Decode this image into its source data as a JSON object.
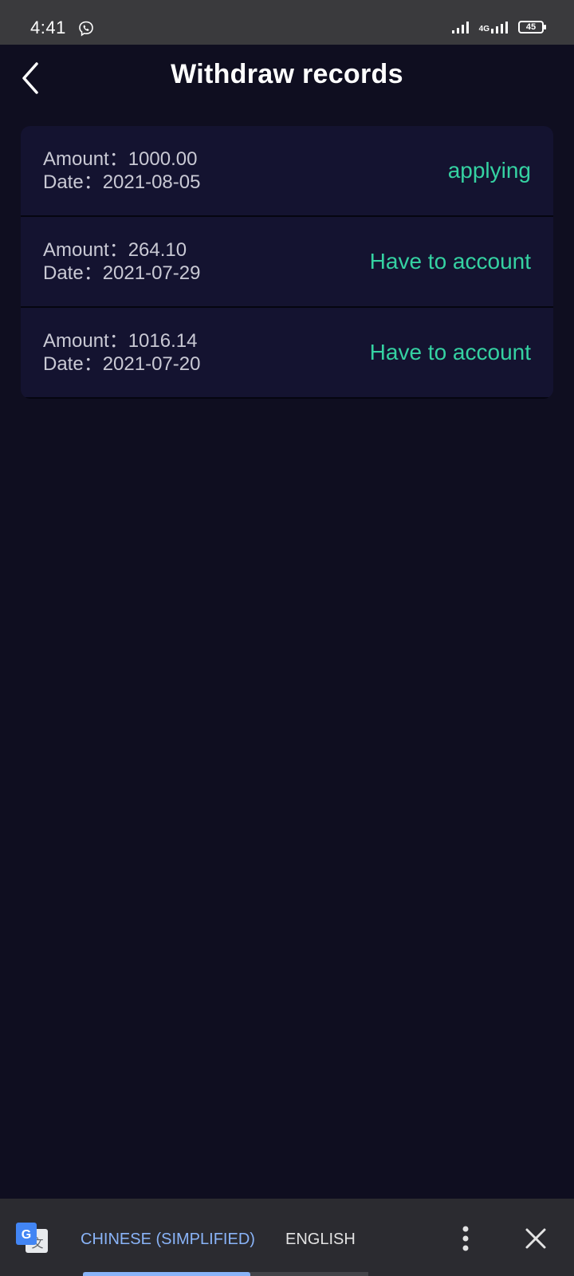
{
  "status_bar": {
    "time": "4:41",
    "network": "4G",
    "battery": "45"
  },
  "header": {
    "title": "Withdraw records"
  },
  "records": [
    {
      "amount_line": "Amount：1000.00",
      "date_line": "Date：2021-08-05",
      "status": "applying"
    },
    {
      "amount_line": "Amount：264.10",
      "date_line": "Date：2021-07-29",
      "status": "Have to account"
    },
    {
      "amount_line": "Amount：1016.14",
      "date_line": "Date：2021-07-20",
      "status": "Have to account"
    }
  ],
  "translate_bar": {
    "source_language": "CHINESE (SIMPLIFIED)",
    "target_language": "ENGLISH"
  },
  "colors": {
    "background": "#0f0e20",
    "card": "#141330",
    "status_accent": "#35d2a2",
    "translate_accent": "#8ab4f8"
  },
  "icons": {
    "status_app": "viber-icon",
    "back": "chevron-left-icon",
    "translate": "google-translate-icon",
    "more": "more-vert-icon",
    "close": "close-icon"
  }
}
